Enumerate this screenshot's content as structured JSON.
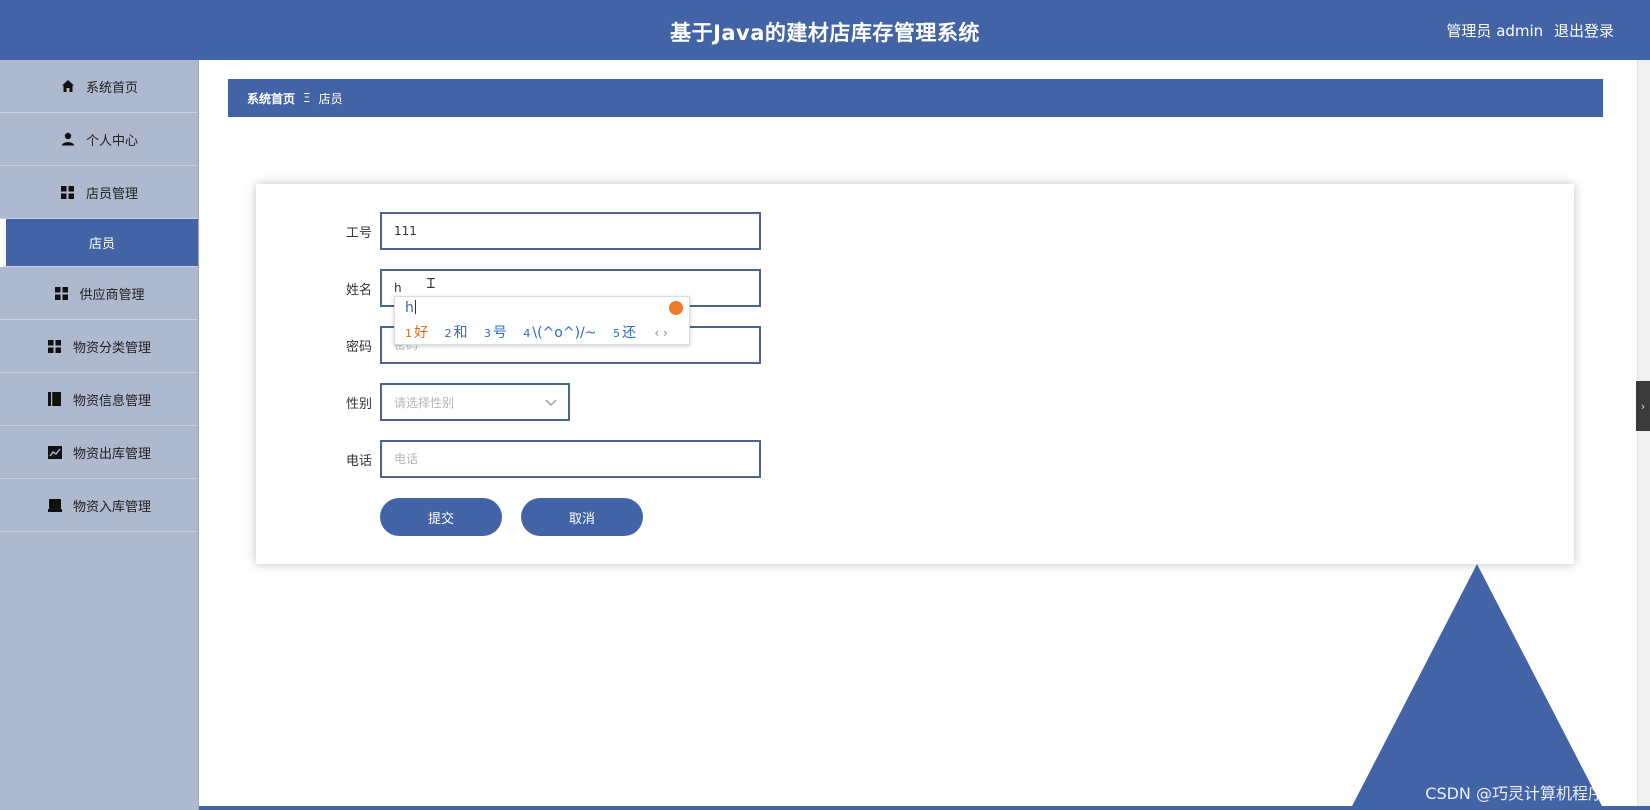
{
  "header": {
    "title": "基于Java的建材店库存管理系统",
    "user_label": "管理员 admin",
    "logout_label": "退出登录"
  },
  "sidebar": {
    "items": [
      {
        "label": "系统首页",
        "icon": "home-icon"
      },
      {
        "label": "个人中心",
        "icon": "user-icon"
      },
      {
        "label": "店员管理",
        "icon": "grid-icon"
      },
      {
        "label": "店员",
        "icon": "",
        "active": true
      },
      {
        "label": "供应商管理",
        "icon": "grid-icon"
      },
      {
        "label": "物资分类管理",
        "icon": "grid-icon"
      },
      {
        "label": "物资信息管理",
        "icon": "book-icon"
      },
      {
        "label": "物资出库管理",
        "icon": "chart-icon"
      },
      {
        "label": "物资入库管理",
        "icon": "inbox-icon"
      }
    ]
  },
  "breadcrumb": {
    "home": "系统首页",
    "separator": "Ξ",
    "current": "店员"
  },
  "form": {
    "fields": [
      {
        "label": "工号",
        "value": "111",
        "placeholder": ""
      },
      {
        "label": "姓名",
        "value": "h",
        "placeholder": ""
      },
      {
        "label": "密码",
        "value": "",
        "placeholder": "密码"
      },
      {
        "label": "性别",
        "value": "",
        "placeholder": "请选择性别"
      },
      {
        "label": "电话",
        "value": "",
        "placeholder": "电话"
      }
    ],
    "submit_label": "提交",
    "cancel_label": "取消"
  },
  "ime": {
    "composition": "h",
    "candidates": [
      {
        "num": "1",
        "text": "好"
      },
      {
        "num": "2",
        "text": "和"
      },
      {
        "num": "3",
        "text": "号"
      },
      {
        "num": "4",
        "text": "\\(^o^)/~"
      },
      {
        "num": "5",
        "text": "还"
      }
    ],
    "nav": "‹ ›"
  },
  "watermark": "CSDN @巧灵计算机程序设计",
  "colors": {
    "primary": "#4264a6",
    "sidebar_bg": "#aeb8cf",
    "ime_highlight": "#e56a1e"
  }
}
